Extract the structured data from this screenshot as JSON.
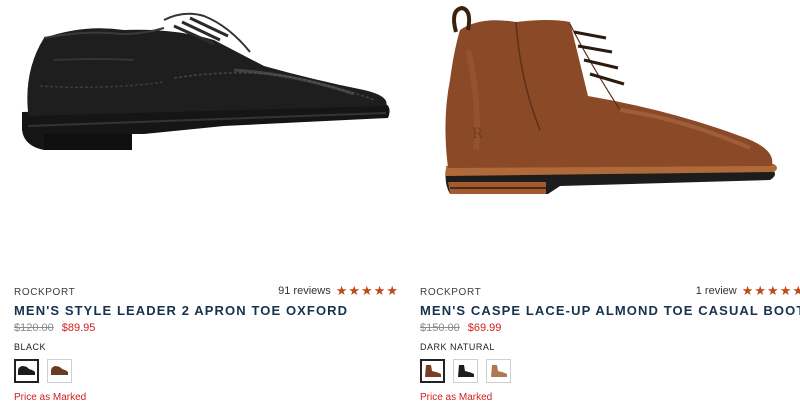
{
  "products": [
    {
      "brand": "ROCKPORT",
      "reviews": "91 reviews",
      "rating": 5,
      "title": "MEN'S STYLE LEADER 2 APRON TOE OXFORD",
      "price_original": "$120.00",
      "price_sale": "$89.95",
      "color_name": "BLACK",
      "swatches": [
        "black",
        "brown"
      ],
      "note": "Price as Marked"
    },
    {
      "brand": "ROCKPORT",
      "reviews": "1 review",
      "rating": 5,
      "title": "MEN'S CASPE LACE-UP ALMOND TOE CASUAL BOOTS",
      "price_original": "$150.00",
      "price_sale": "$69.99",
      "color_name": "DARK NATURAL",
      "swatches": [
        "dark-natural",
        "black",
        "tan"
      ],
      "note": "Price as Marked"
    }
  ],
  "colors": {
    "star": "#c04a12",
    "title": "#16324f",
    "sale": "#d21e1e",
    "oxford": "#1c1c1c",
    "boot": "#8a4a28"
  }
}
